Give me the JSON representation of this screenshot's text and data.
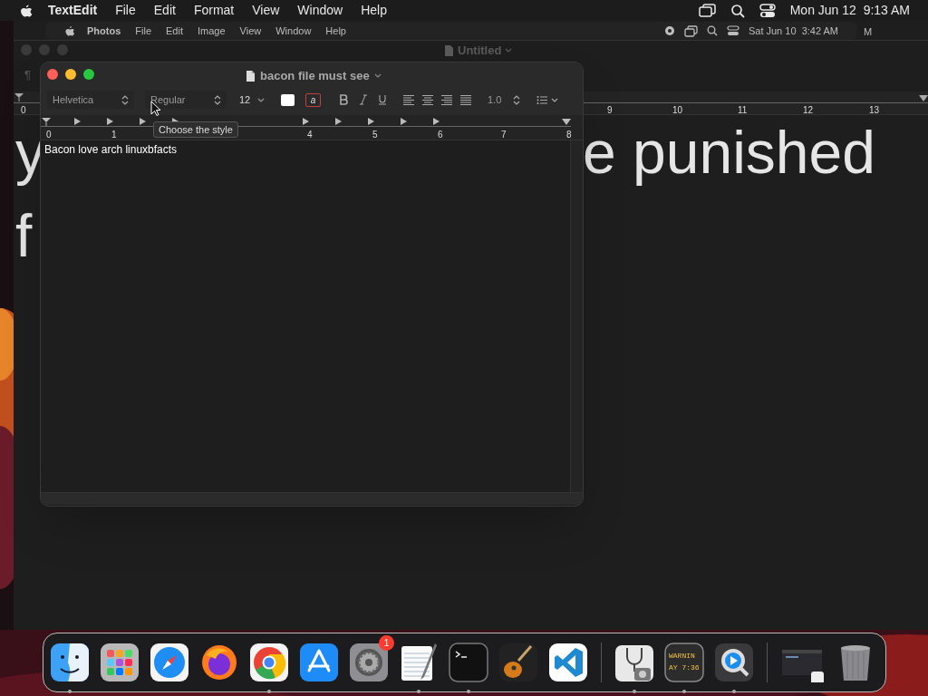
{
  "menu_bar": {
    "app": "TextEdit",
    "items": [
      "File",
      "Edit",
      "Format",
      "View",
      "Window",
      "Help"
    ],
    "clock": "Mon Jun 12  9:13 AM"
  },
  "remote_screen": {
    "menu_bar": {
      "app": "Photos",
      "items": [
        "File",
        "Edit",
        "Image",
        "View",
        "Window",
        "Help"
      ],
      "clock": "Sat Jun 10  3:42 AM",
      "cut_text": "M"
    },
    "back_window": {
      "title": "Untitled",
      "paragraph_mark": "¶",
      "ruler_numbers": [
        "0",
        "9",
        "10",
        "11",
        "12",
        "13"
      ],
      "text_fragments": [
        "y",
        "e punished",
        "f"
      ]
    }
  },
  "window": {
    "title": "bacon file must see",
    "toolbar": {
      "font": "Helvetica",
      "style": "Regular",
      "size": "12",
      "highlight_glyph": "a",
      "line_spacing": "1.0"
    },
    "ruler_numbers": [
      "0",
      "1",
      "4",
      "5",
      "6",
      "7",
      "8"
    ],
    "tooltip": "Choose the style",
    "text": "Bacon love arch linuxbfacts"
  },
  "dock": {
    "items": [
      {
        "kind": "finder",
        "running": true
      },
      {
        "kind": "launchpad",
        "running": false
      },
      {
        "kind": "safari",
        "running": false
      },
      {
        "kind": "firefox",
        "running": false
      },
      {
        "kind": "chrome",
        "running": true
      },
      {
        "kind": "appstore",
        "running": false
      },
      {
        "kind": "settings",
        "running": false,
        "badge": "1"
      },
      {
        "kind": "textedit",
        "running": true
      },
      {
        "kind": "terminal",
        "running": true
      },
      {
        "kind": "garageband",
        "running": false
      },
      {
        "kind": "vscode",
        "running": false
      },
      {
        "kind": "divider"
      },
      {
        "kind": "diskutility",
        "running": true
      },
      {
        "kind": "console",
        "running": true,
        "icon_text": [
          "WARNIN",
          "AY 7:36"
        ]
      },
      {
        "kind": "quicktime",
        "running": true
      },
      {
        "kind": "divider"
      },
      {
        "kind": "window-thumb",
        "running": false
      },
      {
        "kind": "trash",
        "running": false
      }
    ]
  }
}
